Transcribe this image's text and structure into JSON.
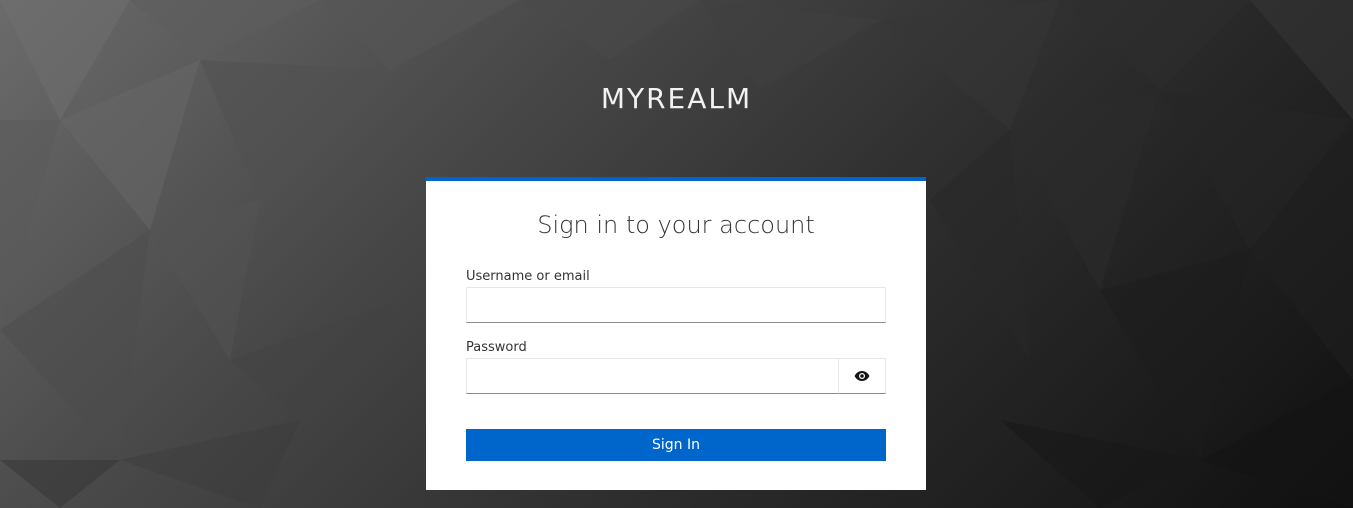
{
  "background": {
    "description_colors": [
      "#6b6b6b",
      "#2e2e2e",
      "#101010"
    ]
  },
  "realm": {
    "title": "MYREALM"
  },
  "login": {
    "heading": "Sign in to your account",
    "username_label": "Username or email",
    "username_value": "",
    "password_label": "Password",
    "password_value": "",
    "show_password_icon": "eye-icon",
    "submit_label": "Sign In"
  },
  "colors": {
    "accent": "#0066cc",
    "card": "#ffffff"
  }
}
